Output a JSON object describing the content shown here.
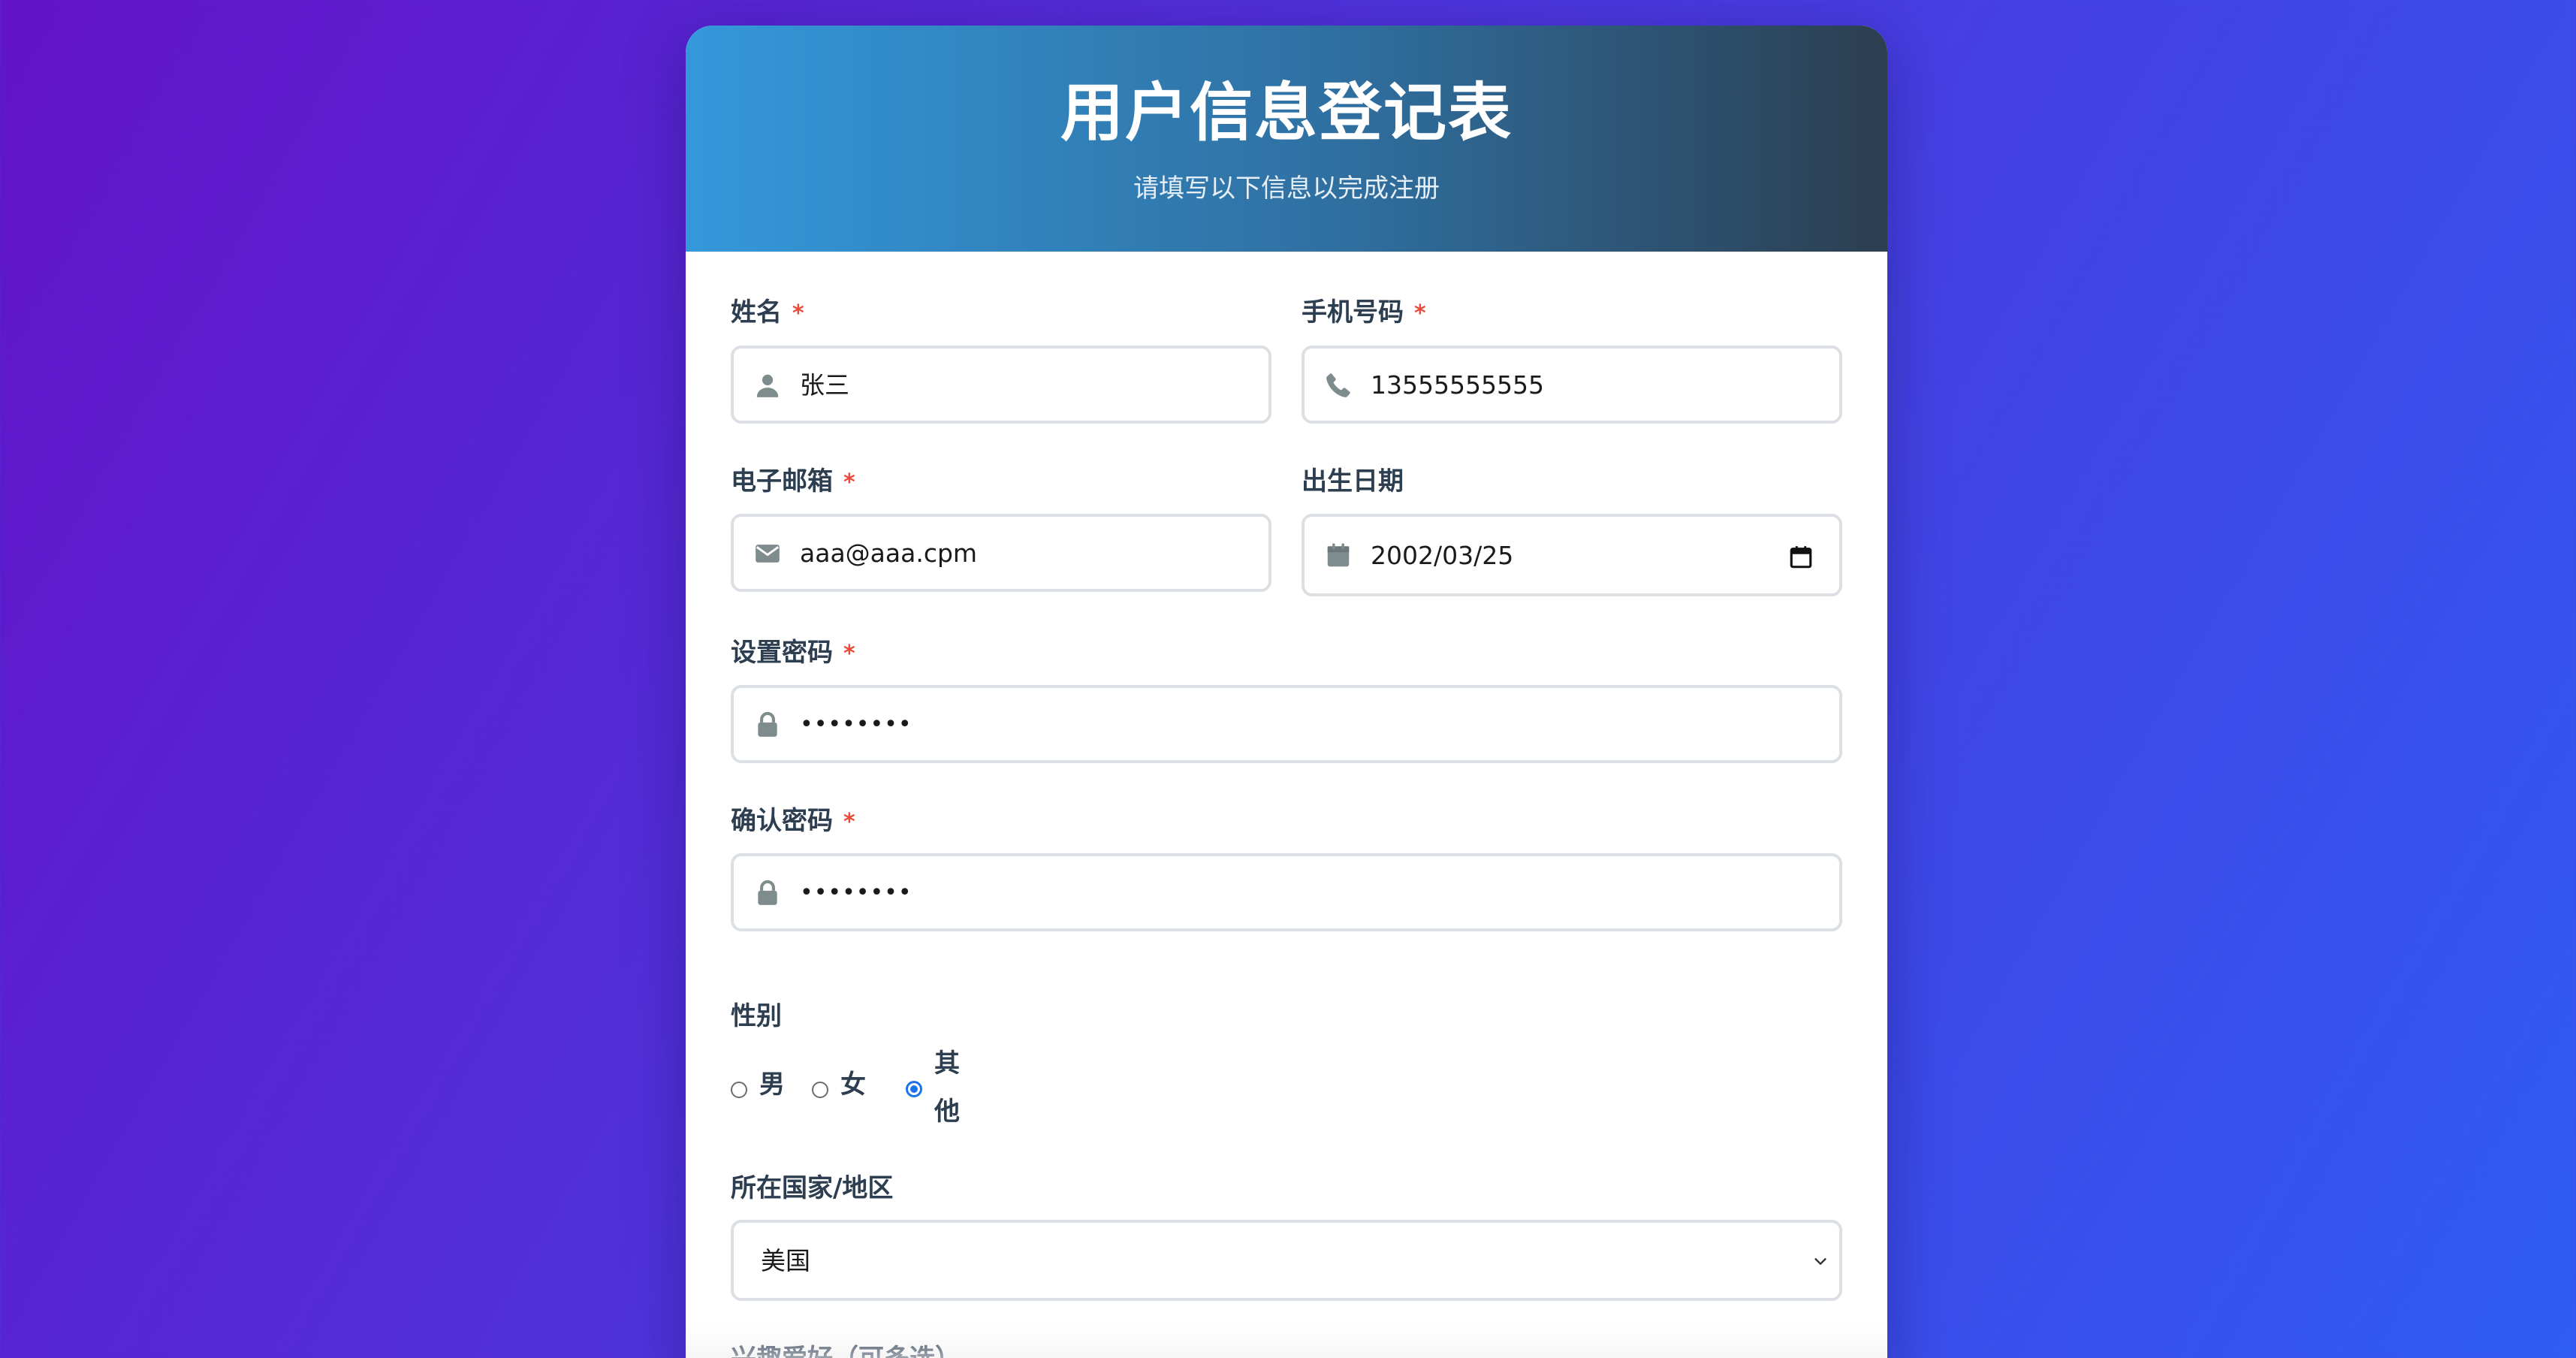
{
  "header": {
    "title": "用户信息登记表",
    "subtitle": "请填写以下信息以完成注册"
  },
  "required_mark": "*",
  "fields": {
    "name": {
      "label": "姓名",
      "value": "张三",
      "icon": "user-icon"
    },
    "phone": {
      "label": "手机号码",
      "value": "13555555555",
      "icon": "phone-icon"
    },
    "email": {
      "label": "电子邮箱",
      "value": "aaa@aaa.cpm",
      "icon": "envelope-icon"
    },
    "birthday": {
      "label": "出生日期",
      "value": "2002/03/25",
      "icon": "calendar-icon"
    },
    "password": {
      "label": "设置密码",
      "value": "••••••••",
      "icon": "lock-icon"
    },
    "confirm_password": {
      "label": "确认密码",
      "value": "••••••••",
      "icon": "lock-icon"
    }
  },
  "gender": {
    "label": "性别",
    "options": [
      {
        "label": "男",
        "checked": false
      },
      {
        "label": "女",
        "checked": false
      },
      {
        "label_line1": "其",
        "label_line2": "他",
        "checked": true
      }
    ]
  },
  "country": {
    "label": "所在国家/地区",
    "selected": "美国",
    "icon": "chevron-down-icon"
  },
  "hobbies": {
    "label": "兴趣爱好（可多选）"
  },
  "colors": {
    "accent_blue": "#3498db",
    "header_dark": "#2c3e50",
    "required_red": "#e74c3c",
    "radio_blue": "#1a73e8"
  }
}
